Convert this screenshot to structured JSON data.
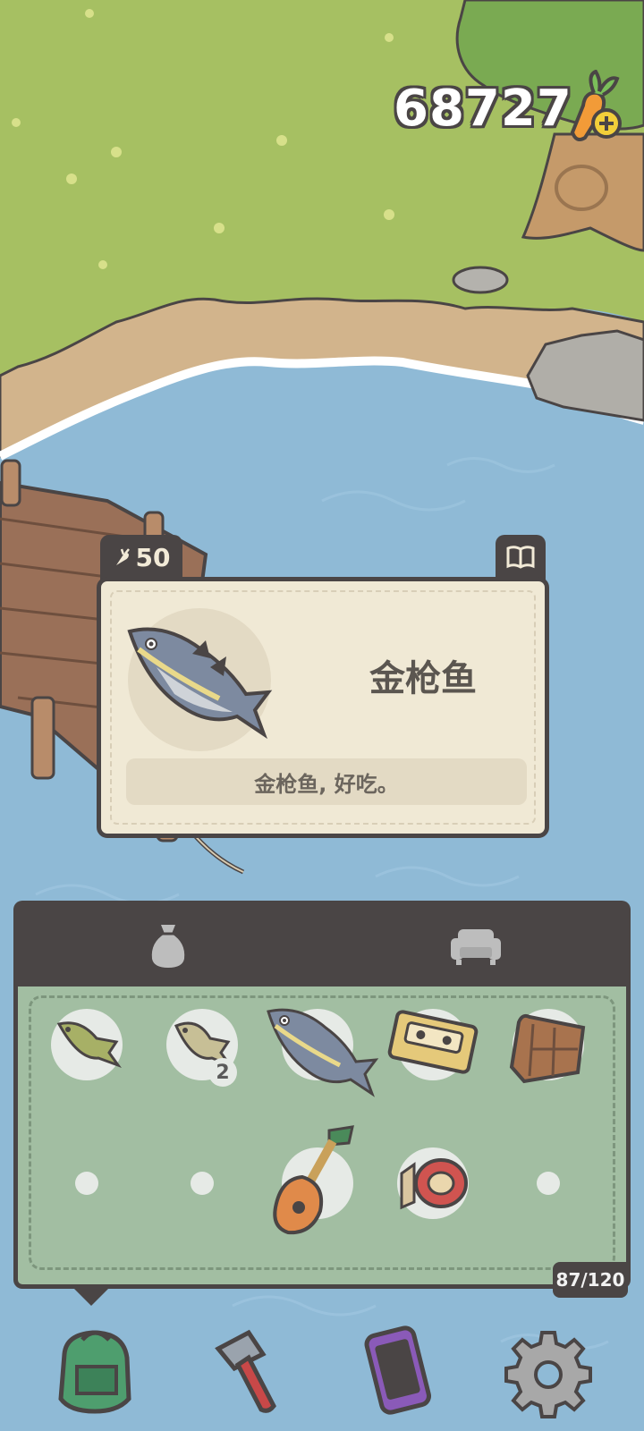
{
  "currency": {
    "carrots": "68727",
    "icon": "carrot-plus-icon"
  },
  "detail": {
    "price": "50",
    "price_icon": "carrot-icon",
    "book_icon": "book-icon",
    "name": "金枪鱼",
    "description": "金枪鱼, 好吃。"
  },
  "inventory": {
    "tabs": [
      {
        "icon": "bag-icon",
        "active": true
      },
      {
        "icon": "sofa-icon",
        "active": false
      }
    ],
    "slots": [
      {
        "item": "fish-small-icon",
        "count": ""
      },
      {
        "item": "fish-bream-icon",
        "count": "2"
      },
      {
        "item": "tuna-icon",
        "count": ""
      },
      {
        "item": "cassette-icon",
        "count": ""
      },
      {
        "item": "wood-planks-icon",
        "count": ""
      },
      {
        "item": "",
        "count": ""
      },
      {
        "item": "",
        "count": ""
      },
      {
        "item": "lute-icon",
        "count": ""
      },
      {
        "item": "tape-roll-icon",
        "count": ""
      },
      {
        "item": "",
        "count": ""
      }
    ],
    "capacity": "87/120"
  },
  "nav": [
    {
      "icon": "backpack-icon",
      "active": true
    },
    {
      "icon": "hammer-icon",
      "active": false
    },
    {
      "icon": "phone-icon",
      "active": false
    },
    {
      "icon": "gear-icon",
      "active": false
    }
  ],
  "colors": {
    "outline": "#4a4545",
    "card": "#f0e9d5",
    "inventory": "#a2bea2",
    "water": "#8fbad6",
    "grass": "#a6c062"
  }
}
